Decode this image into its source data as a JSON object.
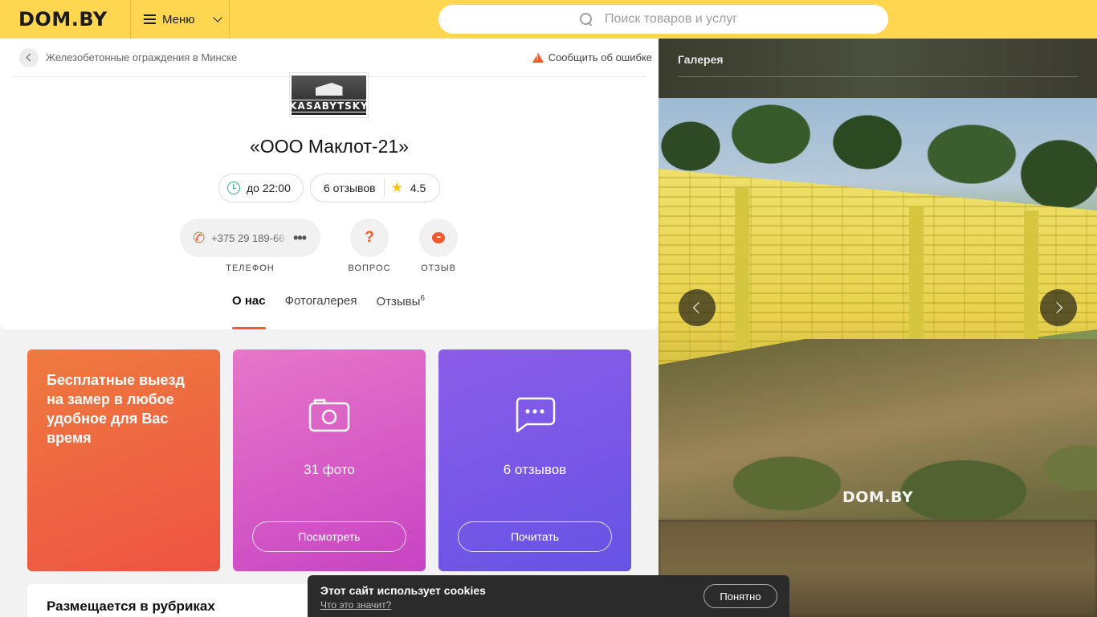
{
  "header": {
    "logo": "DOM.BY",
    "menu_label": "Меню",
    "search_placeholder": "Поиск товаров и услуг"
  },
  "breadcrumb": {
    "back_label": "Железобетонные ограждения в Минске",
    "report_label": "Сообщить об ошибке"
  },
  "company": {
    "logo_text": "KASABYTSKY",
    "name": "«ООО Маклот-21»",
    "hours": "до 22:00",
    "reviews": "6 отзывов",
    "rating": "4.5",
    "phone": "+375 29 189-66",
    "phone_more": "•••",
    "question_glyph": "?"
  },
  "actions": {
    "phone_label": "ТЕЛЕФОН",
    "question_label": "ВОПРОС",
    "review_label": "ОТЗЫВ"
  },
  "tabs": [
    {
      "label": "О нас",
      "active": true
    },
    {
      "label": "Фотогалерея",
      "active": false
    },
    {
      "label": "Отзывы",
      "count": "6",
      "active": false
    }
  ],
  "tiles": {
    "promo_text": "Бесплатные выезд на замер в любое удобное для Вас время",
    "photos_count": "31 фото",
    "photos_button": "Посмотреть",
    "reviews_count": "6 отзывов",
    "reviews_button": "Почитать",
    "colors": {
      "orange": "#ee5343",
      "pink": "#c843c4",
      "purple": "#6653e6"
    }
  },
  "rubrics_title": "Размещается в рубриках",
  "gallery": {
    "title": "Галерея",
    "watermark": "DOM.BY"
  },
  "cookie": {
    "title": "Этот сайт использует cookies",
    "link": "Что это значит?",
    "button": "Понятно"
  },
  "colors": {
    "header": "#fed64f",
    "accent": "#f25a2a",
    "success": "#2fb37a"
  }
}
